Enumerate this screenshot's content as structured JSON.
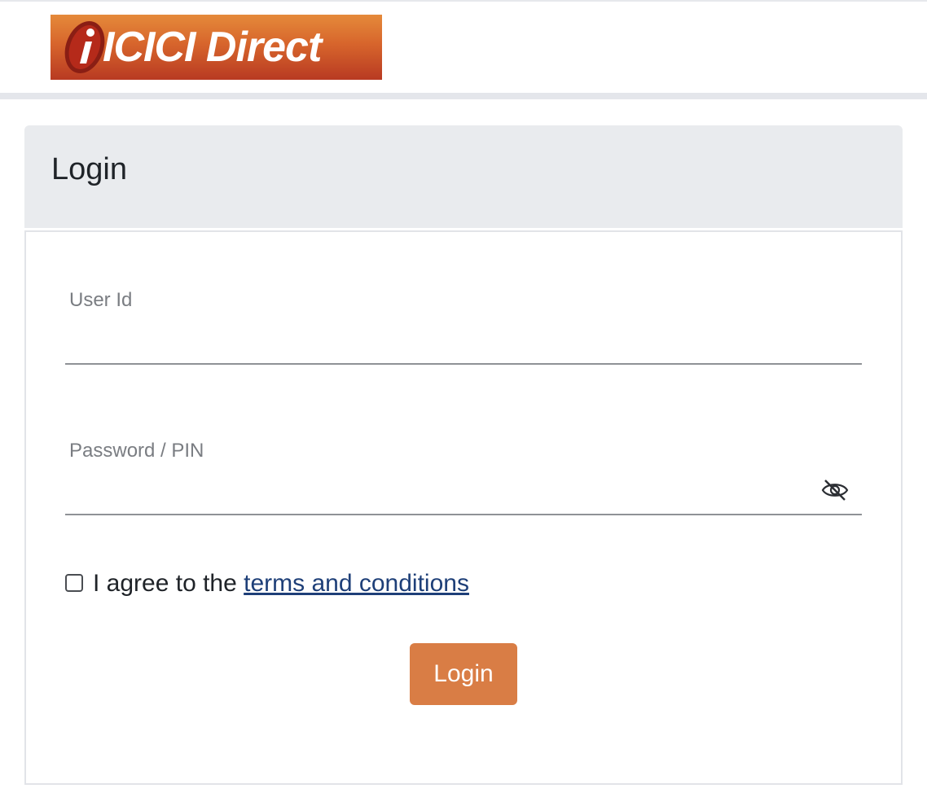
{
  "brand": {
    "logo_text": "ICICI Direct",
    "logo_colors": [
      "#e58a3a",
      "#d7652c",
      "#b83a22"
    ]
  },
  "card": {
    "title": "Login"
  },
  "form": {
    "user_id": {
      "label": "User Id",
      "value": ""
    },
    "password": {
      "label": "Password / PIN",
      "value": "",
      "toggle_icon": "eye-slash-icon"
    },
    "agree": {
      "checked": false,
      "prefix": "I agree to the ",
      "link_text": "terms and conditions"
    },
    "submit_label": "Login",
    "accent_color": "#d97d45",
    "link_color": "#1e3f78"
  }
}
